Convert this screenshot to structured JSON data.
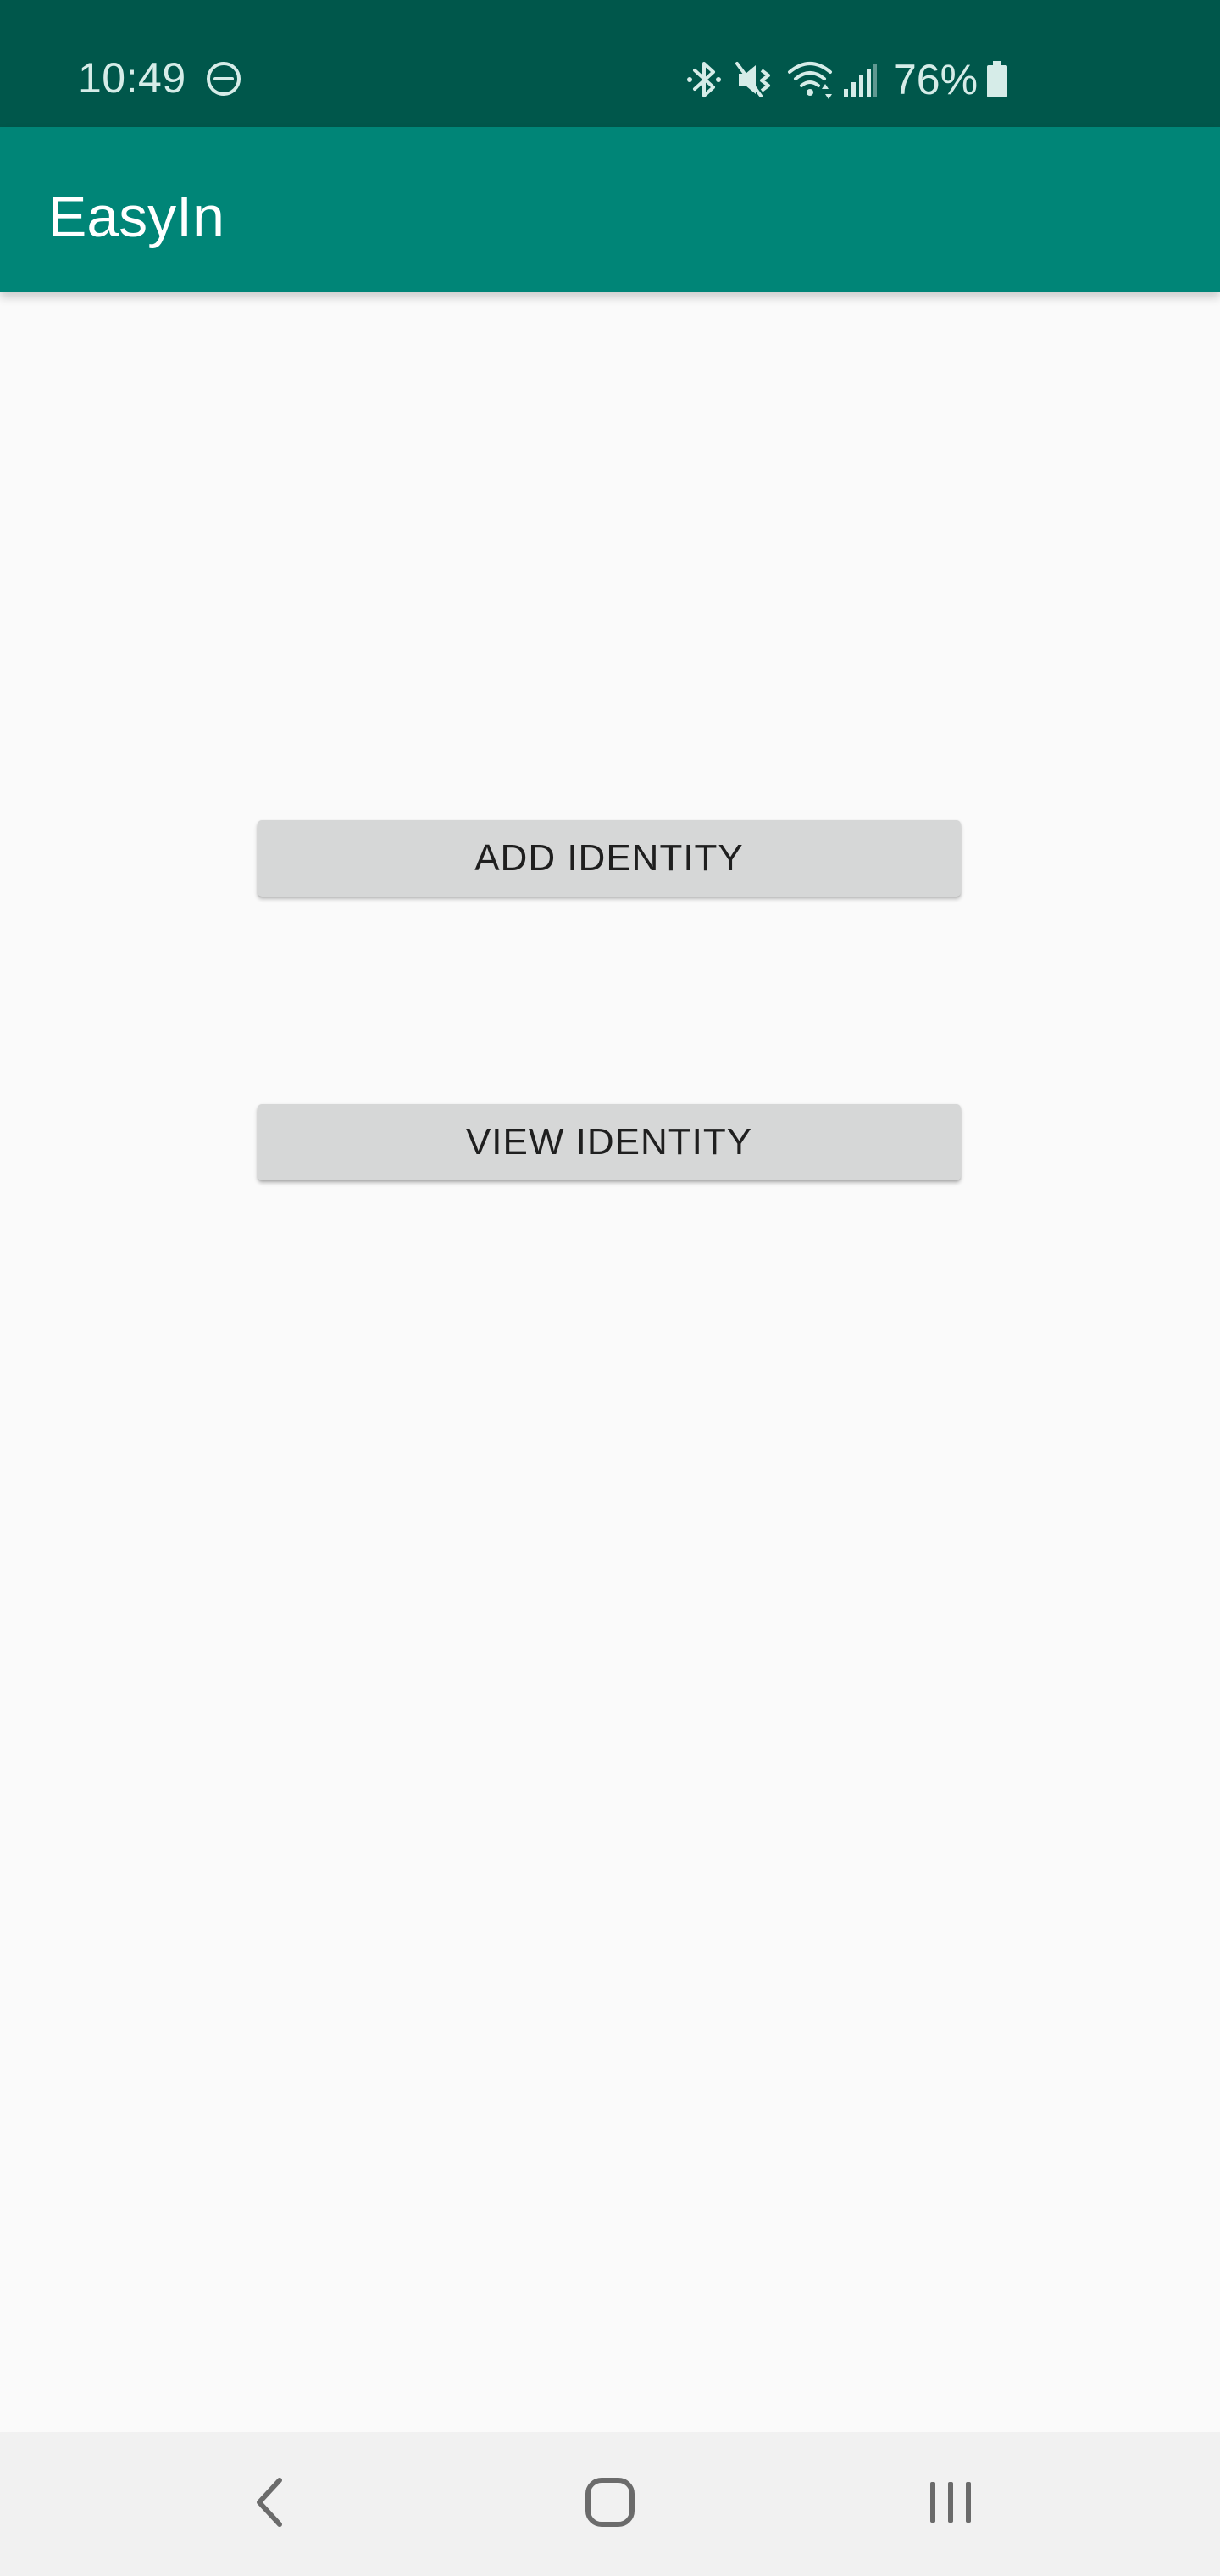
{
  "status_bar": {
    "time": "10:49",
    "battery_percent": "76%",
    "icons": [
      "do-not-disturb-icon",
      "bluetooth-icon",
      "muted-icon",
      "wifi-icon",
      "signal-icon",
      "battery-icon"
    ],
    "background_color": "#00574b"
  },
  "app_bar": {
    "title": "EasyIn",
    "background_color": "#008577"
  },
  "main": {
    "buttons": [
      {
        "label": "ADD IDENTITY"
      },
      {
        "label": "VIEW IDENTITY"
      }
    ],
    "button_color": "#d6d7d7"
  },
  "nav_bar": {
    "icons": [
      "back-icon",
      "home-icon",
      "recent-apps-icon"
    ]
  }
}
